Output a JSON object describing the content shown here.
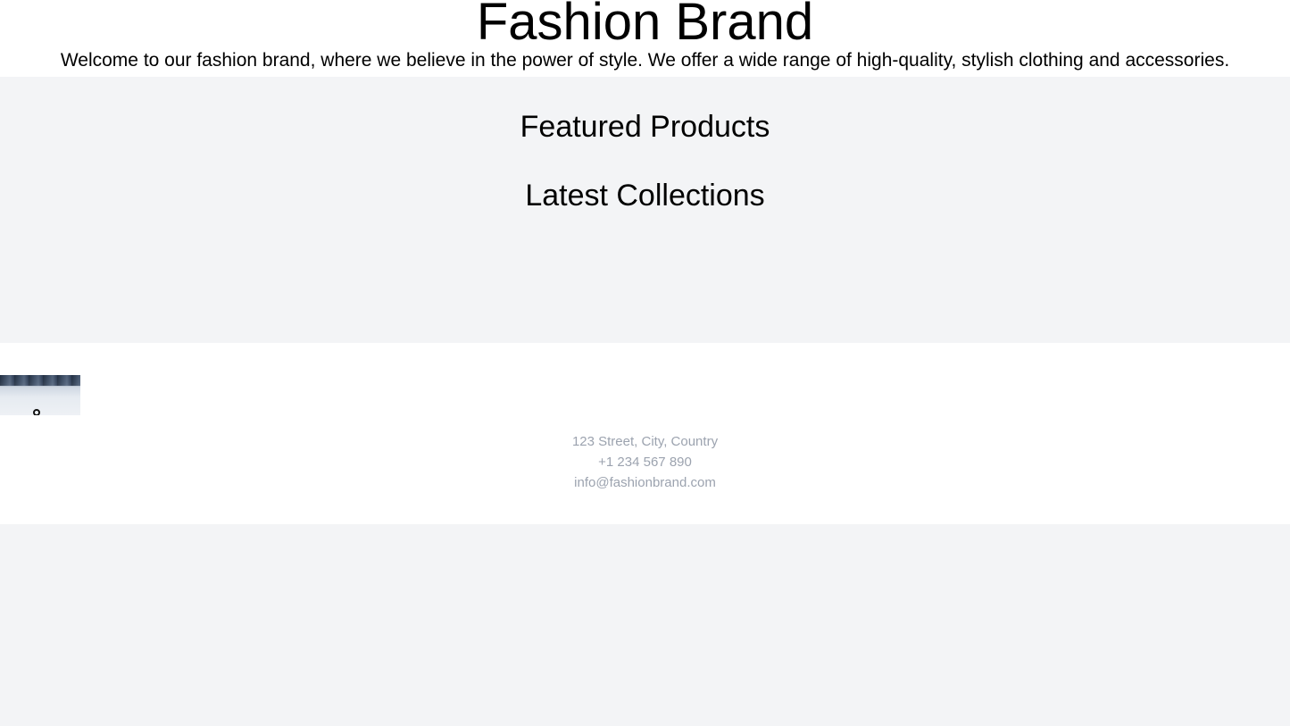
{
  "header": {
    "title": "Fashion Brand",
    "welcome": "Welcome to our fashion brand, where we believe in the power of style. We offer a wide range of high-quality, stylish clothing and accessories."
  },
  "sections": {
    "featured_title": "Featured Products",
    "latest_title": "Latest Collections"
  },
  "footer": {
    "image_icon": "landscape-photo",
    "address": "123 Street, City, Country",
    "phone": "+1 234 567 890",
    "email": "info@fashionbrand.com"
  },
  "colors": {
    "page_background": "#f3f4f6",
    "header_background": "#ffffff",
    "footer_background": "#ffffff",
    "contact_text": "#9ca3af"
  }
}
